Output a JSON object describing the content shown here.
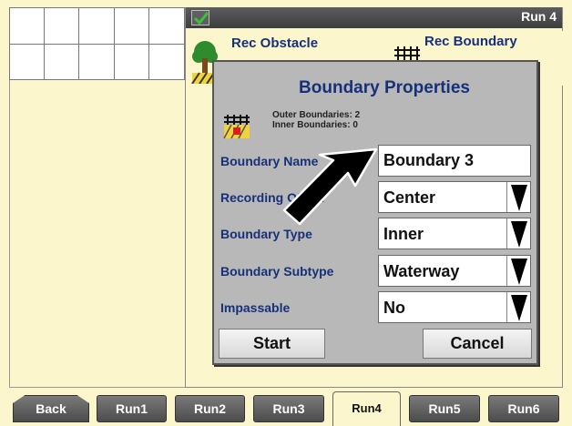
{
  "header": {
    "run_title": "Run 4",
    "rec_obstacle_label": "Rec Obstacle",
    "rec_boundary_label": "Rec Boundary"
  },
  "dialog": {
    "title": "Boundary Properties",
    "outer_boundaries": "Outer Boundaries: 2",
    "inner_boundaries": "Inner Boundaries: 0",
    "fields": {
      "name_label": "Boundary Name",
      "name_value": "Boundary 3",
      "recording_label": "Recording Offset",
      "recording_value": "Center",
      "type_label": "Boundary Type",
      "type_value": "Inner",
      "subtype_label": "Boundary Subtype",
      "subtype_value": "Waterway",
      "impassable_label": "Impassable",
      "impassable_value": "No"
    },
    "start_label": "Start",
    "cancel_label": "Cancel"
  },
  "tabs": {
    "back": "Back",
    "run1": "Run1",
    "run2": "Run2",
    "run3": "Run3",
    "run4": "Run4",
    "run5": "Run5",
    "run6": "Run6",
    "active": "Run4"
  },
  "colors": {
    "background": "#fcf6cc",
    "label_blue": "#16307a",
    "dialog_gray": "#b8b8b8",
    "tab_gray": "#5c5c5c"
  },
  "icons": [
    "check-icon",
    "tree-icon",
    "fence-icon",
    "dropdown-arrow-icon",
    "pointer-arrow-icon"
  ]
}
